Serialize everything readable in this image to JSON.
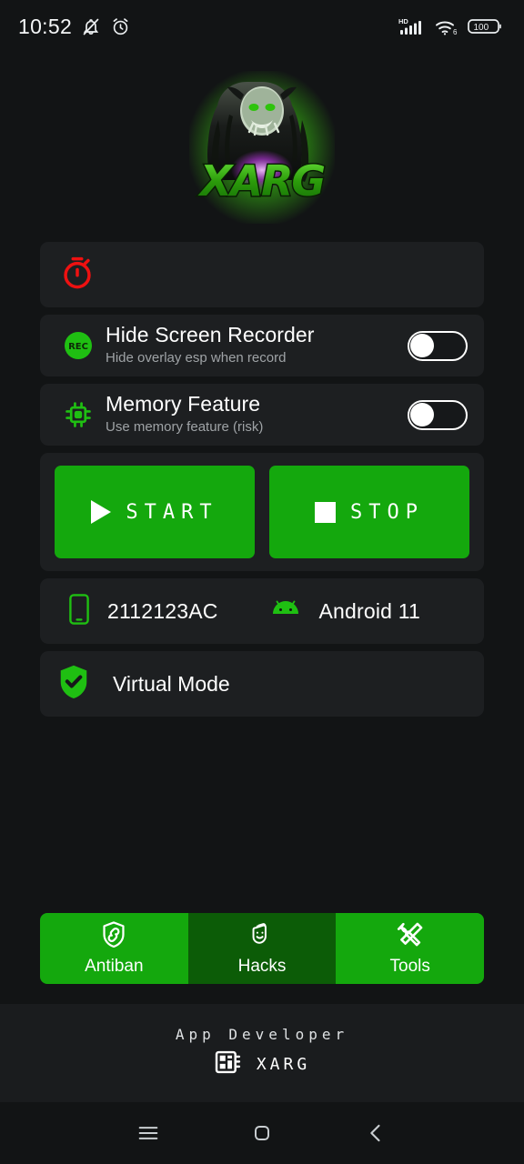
{
  "statusbar": {
    "time": "10:52",
    "icons_left": [
      "bell-mute-icon",
      "alarm-icon"
    ],
    "icons_right": [
      "hd-signal-icon",
      "wifi6-icon",
      "battery-icon"
    ],
    "battery_level": "100"
  },
  "logo": {
    "name": "xarg-logo",
    "wordmark": "XARG",
    "accent": "#3fcc18"
  },
  "timer_card": {
    "icon": "stopwatch-icon",
    "icon_color": "#ee1111",
    "value": ""
  },
  "settings": [
    {
      "icon": "rec-icon",
      "icon_label": "REC",
      "title": "Hide Screen Recorder",
      "subtitle": "Hide overlay esp when record",
      "toggle_state": "off"
    },
    {
      "icon": "cpu-chip-icon",
      "icon_label": "",
      "title": "Memory Feature",
      "subtitle": "Use memory feature (risk)",
      "toggle_state": "off"
    }
  ],
  "actions": {
    "start_label": "START",
    "start_icon": "play-icon",
    "stop_label": "STOP",
    "stop_icon": "stop-icon",
    "color": "#14a80d"
  },
  "device": {
    "phone_icon": "phone-icon",
    "model": "2112123AC",
    "android_icon": "android-icon",
    "os": "Android 11"
  },
  "virtual_mode": {
    "icon": "shield-check-icon",
    "label": "Virtual Mode"
  },
  "bottom_nav": [
    {
      "icon": "shield-link-icon",
      "label": "Antiban",
      "state": "active"
    },
    {
      "icon": "masks-icon",
      "label": "Hacks",
      "state": "pressed"
    },
    {
      "icon": "tools-icon",
      "label": "Tools",
      "state": "active"
    }
  ],
  "footer": {
    "title": "App Developer",
    "icon": "memory-card-icon",
    "developer": "XARG"
  },
  "system_nav": [
    {
      "icon": "recents-icon",
      "name": "recents"
    },
    {
      "icon": "home-icon",
      "name": "home"
    },
    {
      "icon": "back-icon",
      "name": "back"
    }
  ],
  "colors": {
    "background": "#121415",
    "card": "#1d1f21",
    "green": "#14a80d",
    "green_dim": "#0c5c07",
    "red": "#ee1111"
  }
}
